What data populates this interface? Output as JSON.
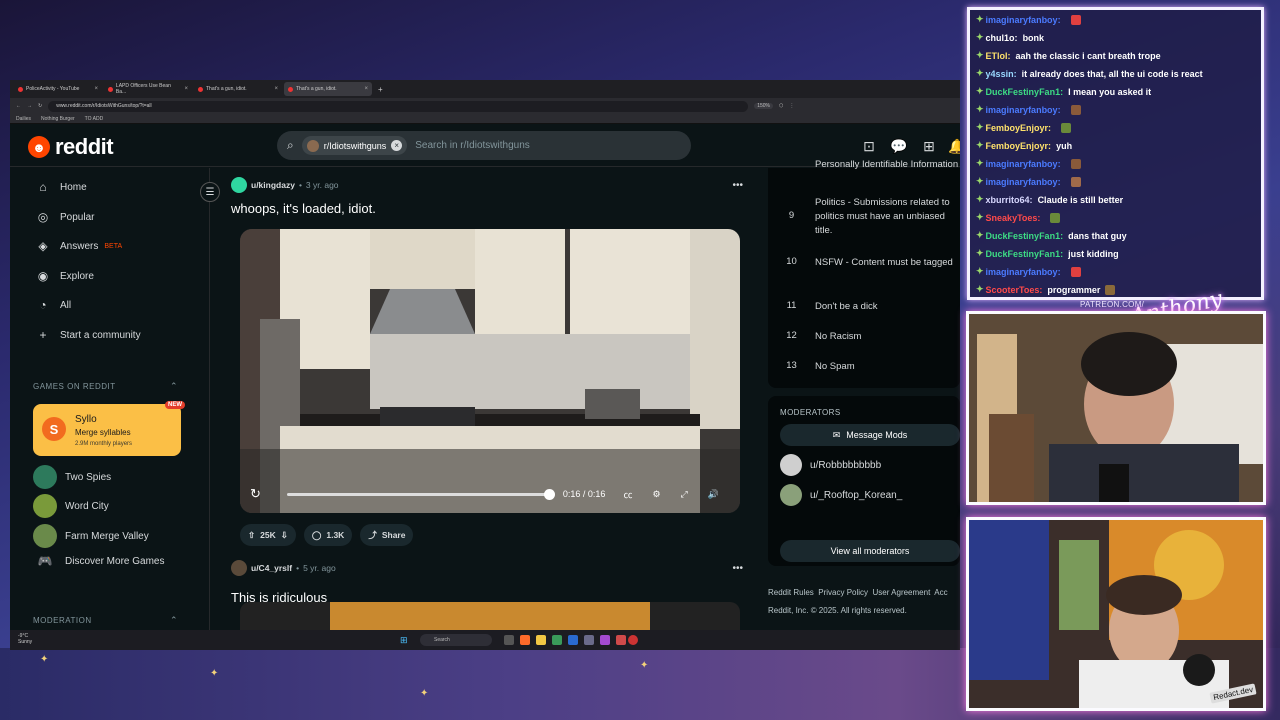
{
  "browser": {
    "tabs": [
      {
        "label": "PoliceActivity - YouTube",
        "active": false
      },
      {
        "label": "LAPD Officers Use Bean Ba...",
        "active": false
      },
      {
        "label": "That's a gun, idiot.",
        "active": false
      },
      {
        "label": "That's a gun, idiot.",
        "active": true
      }
    ],
    "url": "www.reddit.com/r/IdiotsWithGuns/top/?t=all",
    "zoom": "150%",
    "bookmarks": [
      "Dailies",
      "Nothing Burger",
      "TO ADD"
    ]
  },
  "reddit": {
    "logo_text": "reddit",
    "search": {
      "chip": "r/Idiotswithguns",
      "placeholder": "Search in r/Idiotswithguns"
    },
    "nav": [
      {
        "icon": "home-icon",
        "label": "Home"
      },
      {
        "icon": "popular-icon",
        "label": "Popular"
      },
      {
        "icon": "answers-icon",
        "label": "Answers",
        "badge": "BETA"
      },
      {
        "icon": "explore-icon",
        "label": "Explore"
      },
      {
        "icon": "all-icon",
        "label": "All"
      },
      {
        "icon": "plus-icon",
        "label": "Start a community"
      }
    ],
    "games_header": "GAMES ON REDDIT",
    "featured_game": {
      "name": "Syllo",
      "tagline": "Merge syllables",
      "players": "2.9M monthly players",
      "badge": "NEW"
    },
    "games": [
      {
        "label": "Two Spies",
        "color": "#2d7a5c"
      },
      {
        "label": "Word City",
        "color": "#7a9a3a"
      },
      {
        "label": "Farm Merge Valley",
        "color": "#6a8a4a"
      },
      {
        "label": "Discover More Games",
        "color": ""
      }
    ],
    "moderation_header": "MODERATION",
    "posts": [
      {
        "user": "u/kingdazy",
        "age": "3 yr. ago",
        "title": "whoops, it's loaded, idiot.",
        "video_time": "0:16 / 0:16",
        "progress": 1.0,
        "votes": "25K",
        "comments": "1.3K",
        "share": "Share"
      },
      {
        "user": "u/C4_yrslf",
        "age": "5 yr. ago",
        "title": "This is ridiculous"
      }
    ],
    "rules": [
      {
        "n": "",
        "text": "Personally Identifiable Information"
      },
      {
        "n": "9",
        "text": "Politics - Submissions related to politics must have an unbiased title."
      },
      {
        "n": "10",
        "text": "NSFW - Content must be tagged"
      },
      {
        "n": "11",
        "text": "Don't be a dick"
      },
      {
        "n": "12",
        "text": "No Racism"
      },
      {
        "n": "13",
        "text": "No Spam"
      }
    ],
    "moderators_header": "MODERATORS",
    "message_mods": "Message Mods",
    "moderators": [
      "u/Robbbbbbbbb",
      "u/_Rooftop_Korean_"
    ],
    "view_all": "View all moderators",
    "footer_links": "Reddit Rules  Privacy Policy  User Agreement  Acc",
    "footer_copy": "Reddit, Inc. © 2025. All rights reserved."
  },
  "taskbar": {
    "weather_temp": "-9°C",
    "weather_text": "Sunny",
    "search": "Search"
  },
  "chat": [
    {
      "user": "imaginaryfanboy:",
      "msg": "",
      "color": "#4b7bff",
      "emote": "#e04040"
    },
    {
      "user": "chul1o:",
      "msg": "bonk",
      "color": "#ffffff",
      "emote": ""
    },
    {
      "user": "ETlol:",
      "msg": "aah the classic i cant breath trope",
      "color": "#ffe26b",
      "emote": ""
    },
    {
      "user": "y4ssin:",
      "msg": "it already does that, all the ui code is react",
      "color": "#9ad9ff",
      "emote": ""
    },
    {
      "user": "DuckFestinyFan1:",
      "msg": "I mean you asked it",
      "color": "#3ddc84",
      "emote": ""
    },
    {
      "user": "imaginaryfanboy:",
      "msg": "",
      "color": "#4b7bff",
      "emote": "#8a5a3a"
    },
    {
      "user": "FemboyEnjoyr:",
      "msg": "",
      "color": "#ffe26b",
      "emote": "#6a8a3a"
    },
    {
      "user": "FemboyEnjoyr:",
      "msg": "yuh",
      "color": "#ffe26b",
      "emote": ""
    },
    {
      "user": "imaginaryfanboy:",
      "msg": "",
      "color": "#4b7bff",
      "emote": "#8a5a3a"
    },
    {
      "user": "imaginaryfanboy:",
      "msg": "",
      "color": "#4b7bff",
      "emote": "#a06a4a"
    },
    {
      "user": "xburrito64:",
      "msg": "Claude is still better",
      "color": "#d8d8ff",
      "emote": ""
    },
    {
      "user": "SneakyToes:",
      "msg": "",
      "color": "#ff4a4a",
      "emote": "#6a8a3a"
    },
    {
      "user": "DuckFestinyFan1:",
      "msg": "dans that guy",
      "color": "#3ddc84",
      "emote": ""
    },
    {
      "user": "DuckFestinyFan1:",
      "msg": "just kidding",
      "color": "#3ddc84",
      "emote": ""
    },
    {
      "user": "imaginaryfanboy:",
      "msg": "",
      "color": "#4b7bff",
      "emote": "#e04040"
    },
    {
      "user": "ScooterToes:",
      "msg": "programmer",
      "color": "#ff4a4a",
      "emote": "#8a6a3a"
    }
  ],
  "overlay": {
    "patreon": "PATREON.COM/",
    "signature": "Anthony",
    "watermark": "Redact.dev"
  },
  "colors": {
    "reddit_orange": "#ff4500",
    "bg": "#0b1416",
    "beta": "#ff4500"
  }
}
